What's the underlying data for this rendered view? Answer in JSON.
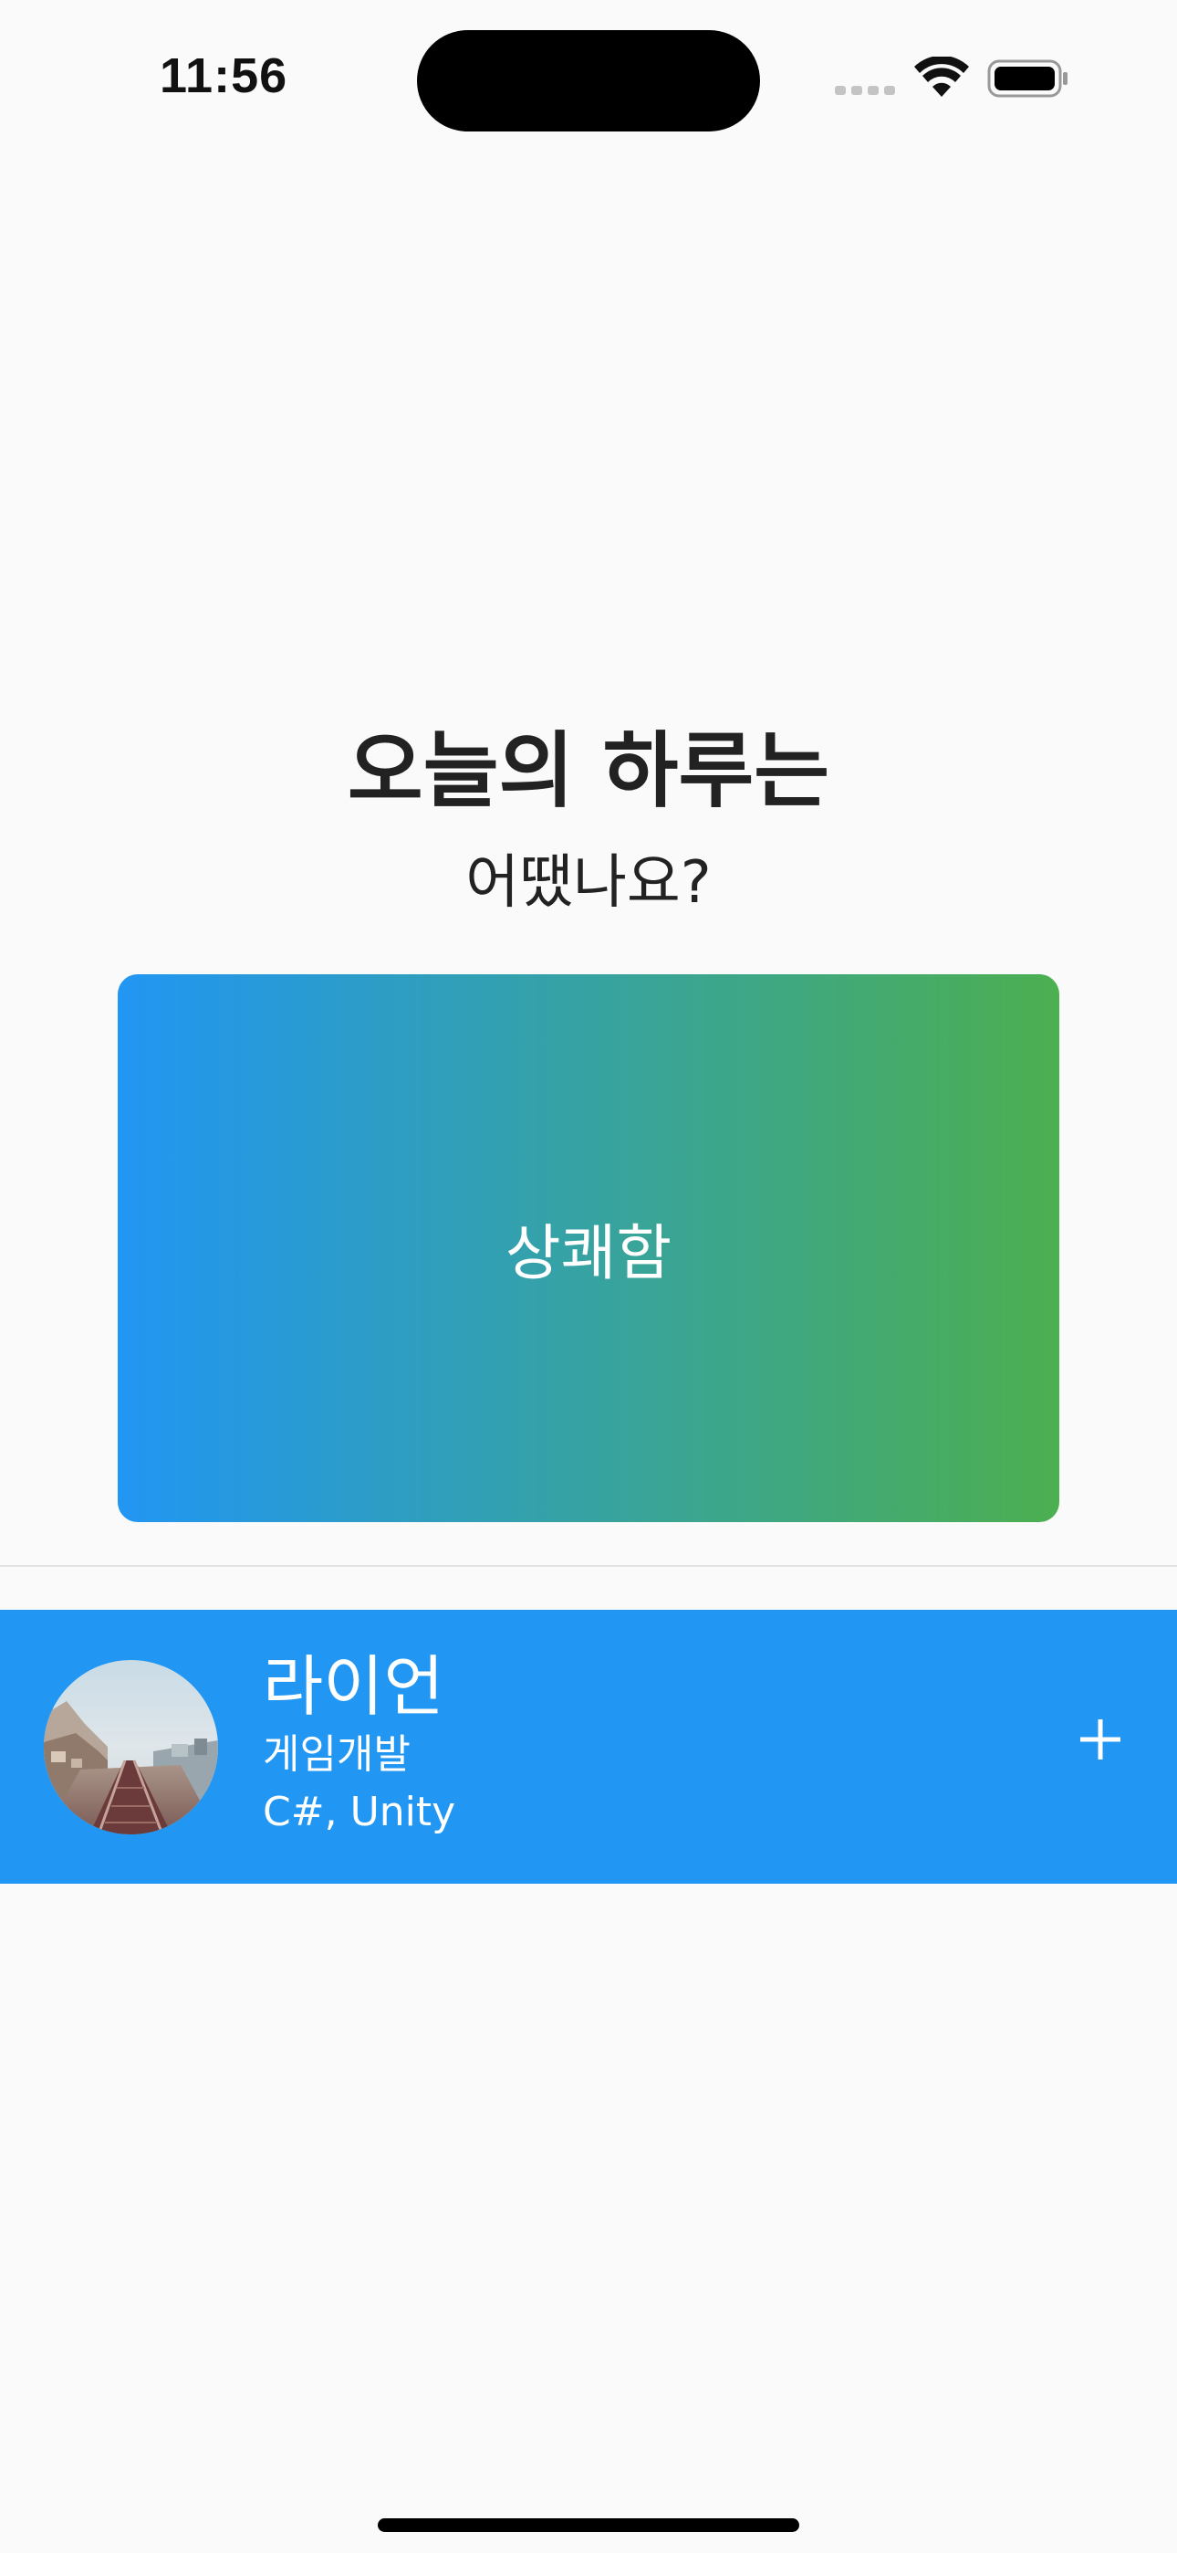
{
  "status_bar": {
    "time": "11:56",
    "icons": [
      "cellular-signal-icon",
      "wifi-icon",
      "battery-icon"
    ]
  },
  "header": {
    "title": "오늘의 하루는",
    "subtitle": "어땠나요?"
  },
  "mood_card": {
    "label": "상쾌함",
    "gradient_start": "#2196F3",
    "gradient_end": "#4CAF50"
  },
  "profile": {
    "name": "라이언",
    "role": "게임개발",
    "skills": "C#, Unity",
    "background_color": "#2196F3",
    "action_icon": "plus-icon"
  },
  "colors": {
    "background": "#FAFAFA",
    "text_primary": "#222222",
    "on_accent": "#FFFFFF"
  }
}
